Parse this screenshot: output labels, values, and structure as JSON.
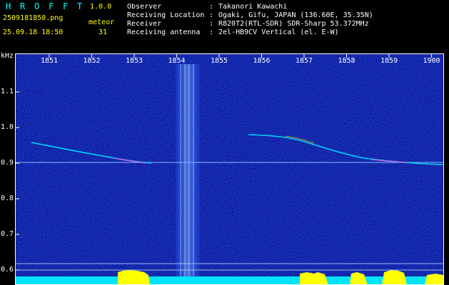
{
  "app": {
    "title_letters": [
      "H",
      "R",
      "O",
      "F",
      "F",
      "T"
    ],
    "version": "1.0.0",
    "filename": "2509181850.png",
    "datetime": "25.09.18 18:50",
    "meteor_label": "meteor",
    "meteor_count": "31"
  },
  "info": {
    "observer_label": "Observer",
    "observer_value": "Takanori Kawachi",
    "location_label": "Receiving Location",
    "location_value": "Ogaki, Gifu, JAPAN (136.60E, 35.35N)",
    "receiver_label": "Receiver",
    "receiver_value": "R820T2(RTL-SDR) SDR-Sharp 53.372MHz",
    "antenna_label": "Receiving antenna",
    "antenna_value": "2el-HB9CV Vertical (el. E-W)",
    "separator": ":"
  },
  "axes": {
    "y_unit": "kHz",
    "y_ticks": [
      "1.1",
      "1.0",
      "0.9",
      "0.8",
      "0.7",
      "0.6"
    ],
    "x_ticks": [
      "1851",
      "1852",
      "1853",
      "1854",
      "1855",
      "1856",
      "1857",
      "1858",
      "1859",
      "1900"
    ]
  },
  "colors": {
    "background": "#000000",
    "spectrogram_bg": "#000a8c",
    "header_text": "#ffffff",
    "title_letters": "#00ffff",
    "version": "#ffff00",
    "yellow_signal": "#ffff00",
    "cyan_signal": "#00e5ff"
  }
}
